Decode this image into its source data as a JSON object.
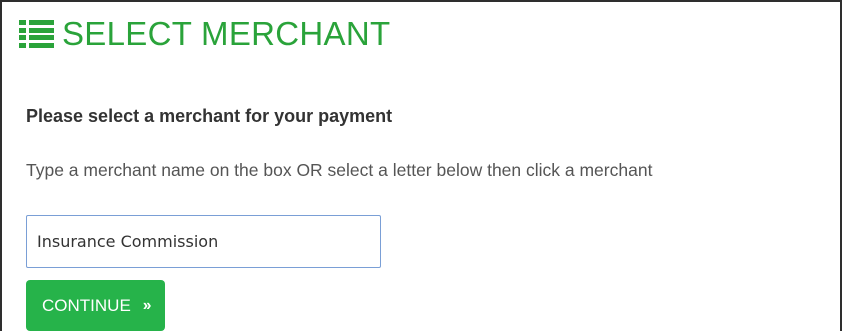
{
  "header": {
    "icon": "list-icon",
    "title": "SELECT MERCHANT"
  },
  "main": {
    "subheading": "Please select a merchant for your payment",
    "instructions": "Type a merchant name on the box OR select a letter below then click a merchant",
    "merchant_input": {
      "value": "Insurance Commission",
      "placeholder": ""
    },
    "continue_button": {
      "label": "CONTINUE",
      "icon": "double-chevron-right-icon"
    }
  },
  "colors": {
    "accent_green": "#2aa33a",
    "button_green": "#26b34a",
    "input_border": "#7a9fd6"
  }
}
